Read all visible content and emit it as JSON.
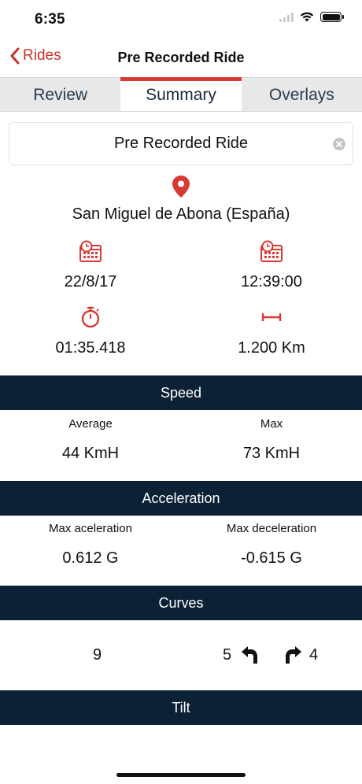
{
  "status_bar": {
    "time": "6:35",
    "icons": [
      "cellular-signal-icon",
      "wifi-icon",
      "battery-icon"
    ]
  },
  "nav": {
    "back_label": "Rides",
    "title": "Pre Recorded Ride",
    "accent_color": "#c8322a"
  },
  "tabs": [
    {
      "label": "Review",
      "active": false
    },
    {
      "label": "Summary",
      "active": true
    },
    {
      "label": "Overlays",
      "active": false
    }
  ],
  "ride_name": {
    "value": "Pre Recorded Ride"
  },
  "location": {
    "icon": "map-pin-icon",
    "text": "San Miguel de Abona (España)"
  },
  "info": {
    "date": {
      "icon": "calendar-clock-icon",
      "value": "22/8/17"
    },
    "time": {
      "icon": "calendar-clock-icon",
      "value": "12:39:00"
    },
    "duration": {
      "icon": "stopwatch-icon",
      "value": "01:35.418"
    },
    "distance": {
      "icon": "distance-icon",
      "value": "1.200 Km"
    }
  },
  "speed": {
    "header": "Speed",
    "average_label": "Average",
    "average_value": "44 KmH",
    "max_label": "Max",
    "max_value": "73 KmH"
  },
  "acceleration": {
    "header": "Acceleration",
    "max_accel_label": "Max aceleration",
    "max_accel_value": "0.612 G",
    "max_decel_label": "Max deceleration",
    "max_decel_value": "-0.615 G"
  },
  "curves": {
    "header": "Curves",
    "total": "9",
    "left": "5",
    "right": "4",
    "left_icon": "turn-left-arrow-icon",
    "right_icon": "turn-right-arrow-icon"
  },
  "tilt": {
    "header": "Tilt"
  },
  "colors": {
    "header_bg": "#0c2036",
    "tab_indicator": "#d63a33",
    "icon_red": "#d63a33"
  }
}
